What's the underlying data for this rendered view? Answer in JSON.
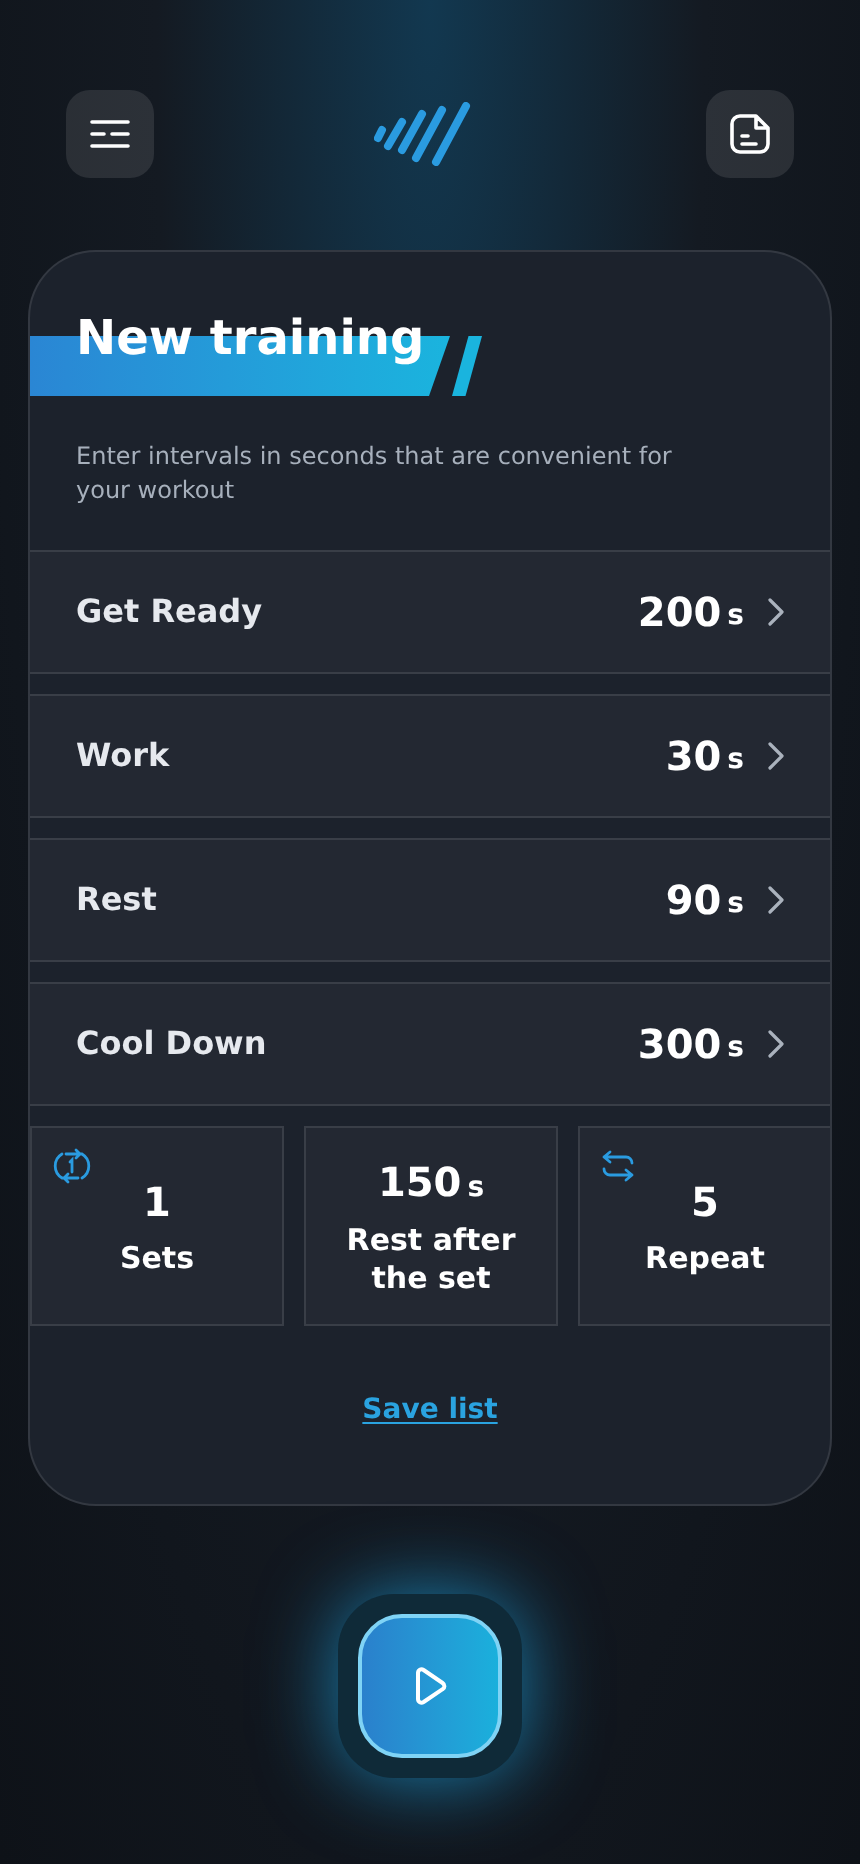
{
  "header": {
    "title": "New training",
    "subtitle": "Enter intervals in seconds that are convenient for your workout"
  },
  "intervals": [
    {
      "label": "Get Ready",
      "value": "200",
      "unit": "s"
    },
    {
      "label": "Work",
      "value": "30",
      "unit": "s"
    },
    {
      "label": "Rest",
      "value": "90",
      "unit": "s"
    },
    {
      "label": "Cool Down",
      "value": "300",
      "unit": "s"
    }
  ],
  "tiles": [
    {
      "kind": "sets",
      "value": "1",
      "label": "Sets"
    },
    {
      "kind": "rest",
      "value": "150",
      "unit": "s",
      "label": "Rest after the set"
    },
    {
      "kind": "repeat",
      "value": "5",
      "label": "Repeat"
    }
  ],
  "save_link": "Save list"
}
